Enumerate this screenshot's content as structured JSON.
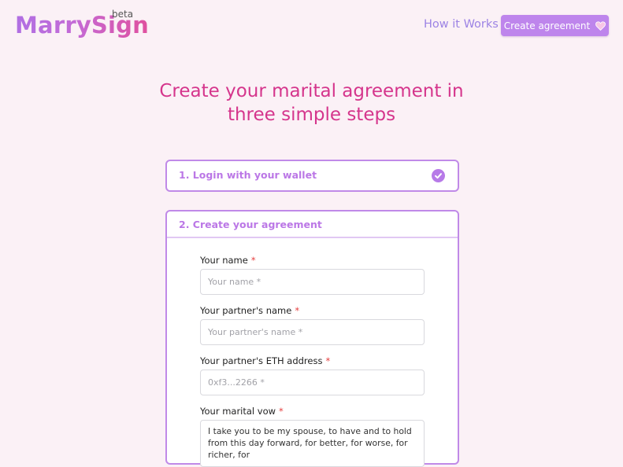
{
  "brand": {
    "name": "MarrySign",
    "tag": "beta"
  },
  "nav": {
    "how_it_works": "How it Works",
    "cta_label": "Create agreement",
    "cta_icon": "heart-icon"
  },
  "headline": {
    "line1": "Create your marital agreement in",
    "line2": "three simple steps"
  },
  "steps": [
    {
      "title": "1. Login with your wallet",
      "status_icon": "check-circle-icon",
      "completed": true
    },
    {
      "title": "2. Create your agreement"
    }
  ],
  "form": {
    "name": {
      "label": "Your name",
      "required": "*",
      "placeholder": "Your name *",
      "value": ""
    },
    "partner_name": {
      "label": "Your partner's name",
      "required": "*",
      "placeholder": "Your partner's name *",
      "value": ""
    },
    "partner_eth": {
      "label": "Your partner's ETH address",
      "required": "*",
      "placeholder": "0xf3...2266 *",
      "value": ""
    },
    "vow": {
      "label": "Your marital vow",
      "required": "*",
      "value": "I take you to be my spouse, to have and to hold from this day forward, for better, for worse, for richer, for"
    }
  },
  "colors": {
    "accent": "#be85ec",
    "headline": "#d5358c",
    "background": "#fbf1f6",
    "required": "#e53e3e"
  }
}
